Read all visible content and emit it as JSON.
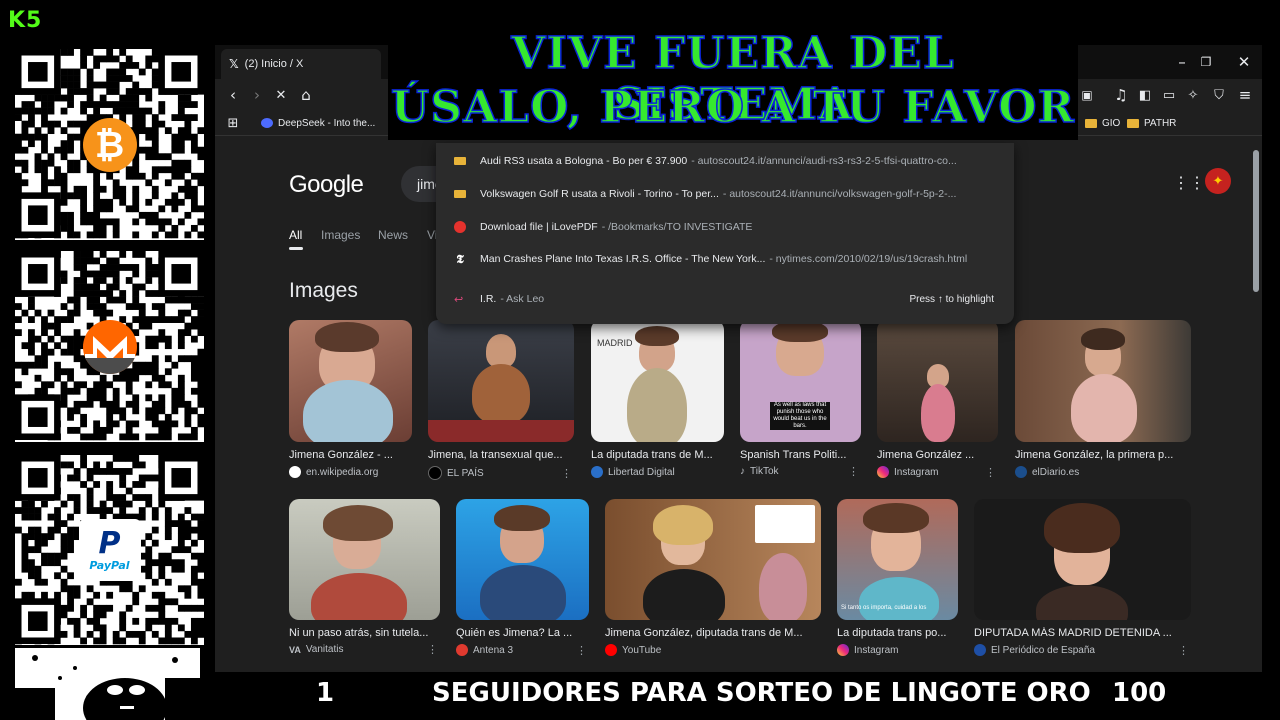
{
  "overlay": {
    "logo": "K5",
    "banner_line1": "VIVE FUERA DEL SISTEMA",
    "banner_line2": "ÚSALO, PERO A TU FAVOR",
    "bottom_left_num": "1",
    "bottom_text": "SEGUIDORES PARA SORTEO DE LINGOTE ORO",
    "bottom_right_num": "100",
    "paypal_label": "PayPal"
  },
  "browser": {
    "tab_title": "(2) Inicio / X",
    "bookmarks": [
      {
        "label": "DeepSeek - Into the..."
      },
      {
        "label": "GIO"
      },
      {
        "label": "PATHR"
      }
    ]
  },
  "google": {
    "logo": "Google",
    "query_fragment": "jime",
    "tabs": [
      "All",
      "Images",
      "News",
      "Vi"
    ],
    "images_heading": "Images"
  },
  "suggestions": [
    {
      "title": "Audi RS3 usata a Bologna - Bo per € 37.900",
      "url": "- autoscout24.it/annunci/audi-rs3-rs3-2-5-tfsi-quattro-co...",
      "icon": "folder-icon"
    },
    {
      "title": "Volkswagen Golf R usata a Rivoli - Torino - To per...",
      "url": "- autoscout24.it/annunci/volkswagen-golf-r-5p-2-...",
      "icon": "folder-icon"
    },
    {
      "title": "Download file | iLovePDF",
      "url": "- /Bookmarks/TO INVESTIGATE",
      "icon": "ilovepdf-icon"
    },
    {
      "title": "Man Crashes Plane Into Texas I.R.S. Office - The New York...",
      "url": "- nytimes.com/2010/02/19/us/19crash.html",
      "icon": "nytimes-icon"
    },
    {
      "title": "I.R.",
      "url": "- Ask Leo",
      "icon": "askleo-icon",
      "hint": "Press ↑ to highlight"
    }
  ],
  "images_row1": [
    {
      "title": "Jimena González - ...",
      "source": "en.wikipedia.org"
    },
    {
      "title": "Jimena, la transexual que...",
      "source": "EL PAÍS"
    },
    {
      "title": "La diputada trans de M...",
      "source": "Libertad Digital"
    },
    {
      "title": "Spanish Trans Politi...",
      "source": "TikTok"
    },
    {
      "title": "Jimena González ...",
      "source": "Instagram"
    },
    {
      "title": "Jimena González, la primera p...",
      "source": "elDiario.es"
    }
  ],
  "images_row2": [
    {
      "title": "Ni un paso atrás, sin tutela...",
      "source": "Vanitatis"
    },
    {
      "title": "Quién es Jimena? La ...",
      "source": "Antena 3"
    },
    {
      "title": "Jimena González, diputada trans de M...",
      "source": "YouTube"
    },
    {
      "title": "La diputada trans po...",
      "source": "Instagram"
    },
    {
      "title": "DIPUTADA MÁS MADRID DETENIDA ...",
      "source": "El Periódico de España"
    }
  ],
  "image_overlay_text": {
    "madrid_sign": "MADRID",
    "tiktok_caption": "As well as laws that punish those who would beat us in the bars.",
    "insta_caption": "Si tanto os importa, cuidad a los"
  },
  "colors": {
    "banner_text": "#36e82f",
    "banner_outline": "#0a25d8",
    "page_bg": "#1f1f1f",
    "btc": "#f7931a",
    "xmr": "#ff6600"
  }
}
